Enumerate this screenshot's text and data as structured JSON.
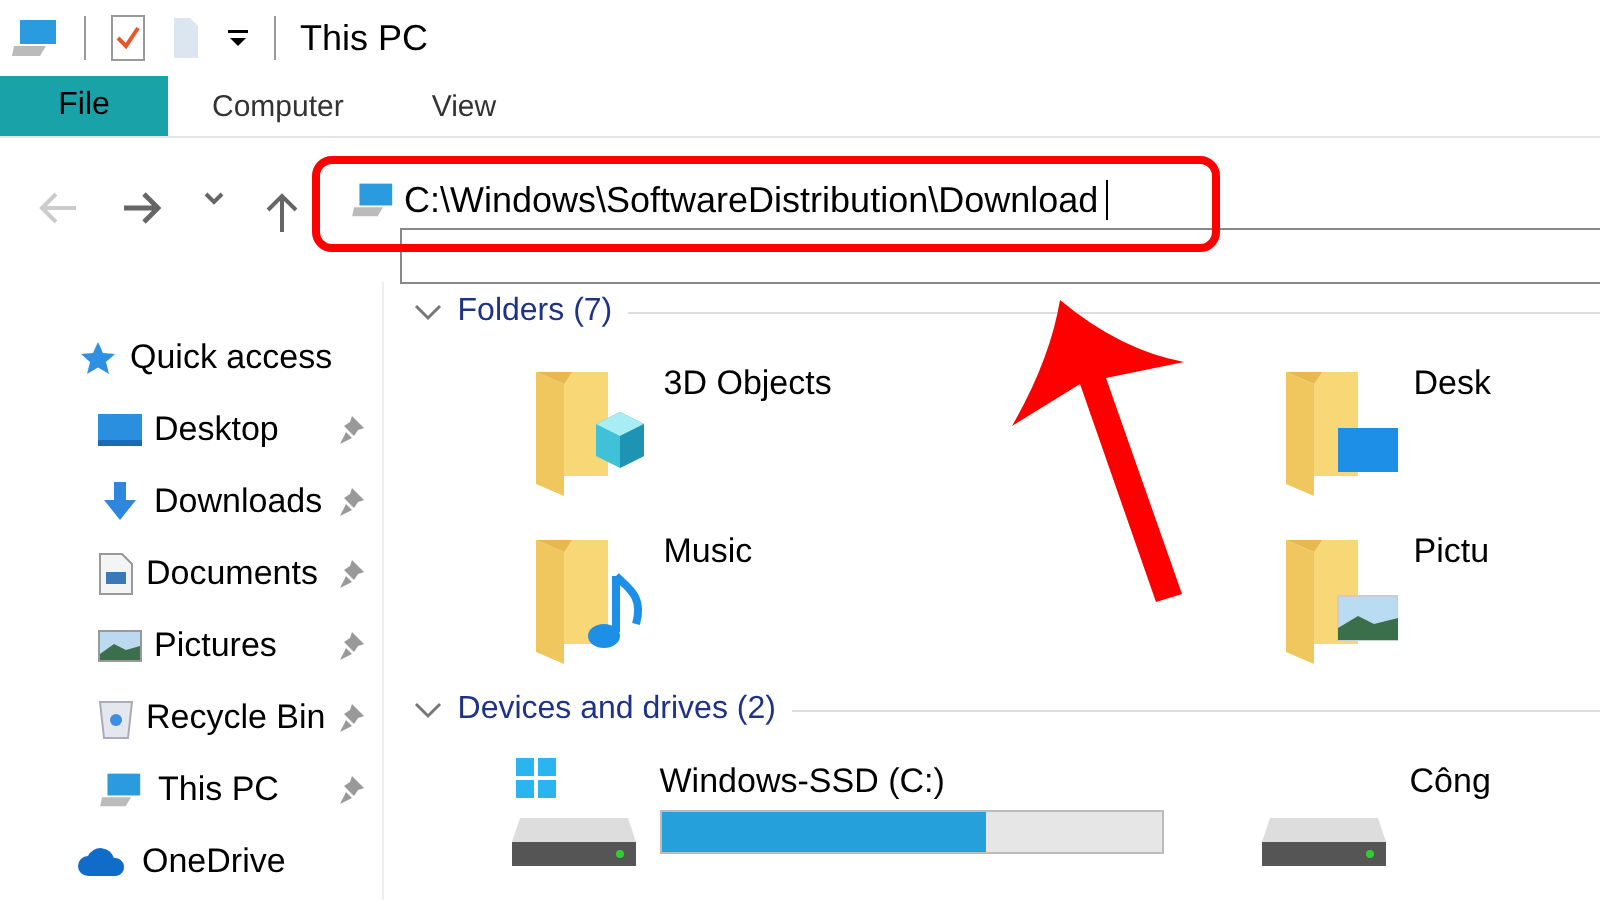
{
  "window": {
    "title": "This PC"
  },
  "ribbon_tabs": [
    {
      "label": "File",
      "selected": true
    },
    {
      "label": "Computer",
      "selected": false
    },
    {
      "label": "View",
      "selected": false
    }
  ],
  "address_bar": {
    "value": "C:\\Windows\\SoftwareDistribution\\Download"
  },
  "sidebar": {
    "items": [
      {
        "label": "Quick access",
        "kind": "quick",
        "pinned": false,
        "children": [
          {
            "label": "Desktop",
            "kind": "desktop",
            "pinned": true
          },
          {
            "label": "Downloads",
            "kind": "downloads",
            "pinned": true
          },
          {
            "label": "Documents",
            "kind": "documents",
            "pinned": true
          },
          {
            "label": "Pictures",
            "kind": "pictures",
            "pinned": true
          },
          {
            "label": "Recycle Bin",
            "kind": "recycle",
            "pinned": true
          },
          {
            "label": "This PC",
            "kind": "pc",
            "pinned": true
          }
        ]
      },
      {
        "label": "OneDrive",
        "kind": "cloud",
        "pinned": false
      }
    ]
  },
  "folders": {
    "heading": "Folders (7)",
    "items": [
      {
        "label": "3D Objects",
        "kind": "cube"
      },
      {
        "label": "Desk",
        "kind": "desktop"
      },
      {
        "label": "Music",
        "kind": "music"
      },
      {
        "label": "Pictu",
        "kind": "pictures"
      }
    ]
  },
  "drives": {
    "heading": "Devices and drives (2)",
    "items": [
      {
        "label": "Windows-SSD (C:)",
        "level": 0.65
      },
      {
        "label": "Công"
      }
    ]
  },
  "callouts": {
    "frame": true,
    "arrow": true
  }
}
